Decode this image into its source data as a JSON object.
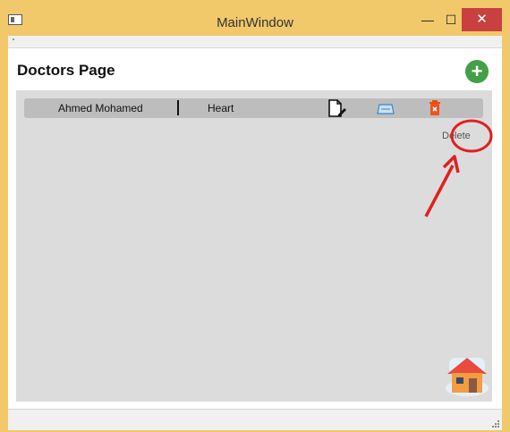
{
  "window": {
    "title": "MainWindow",
    "minimize_glyph": "—",
    "maximize_glyph": "☐",
    "close_glyph": "✕"
  },
  "page": {
    "title": "Doctors Page",
    "add_glyph": "+"
  },
  "doctors": [
    {
      "name": "Ahmed Mohamed",
      "specialty": "Heart"
    }
  ],
  "tooltip": {
    "label": "Delete"
  },
  "icons": {
    "app": "app-window-icon",
    "add": "plus-circle-icon",
    "edit": "edit-document-icon",
    "view": "card-icon",
    "delete": "trash-icon",
    "home": "home-icon"
  },
  "colors": {
    "titlebar": "#f1c86a",
    "close": "#c84040",
    "add": "#43a047",
    "panel": "#dcdcdc",
    "row": "#bdbdbd",
    "delete": "#e53935",
    "annotation": "#e02020"
  }
}
